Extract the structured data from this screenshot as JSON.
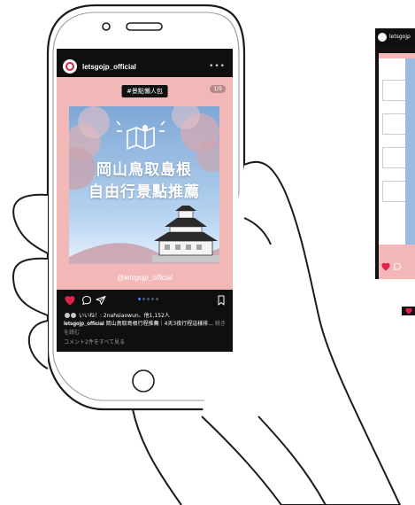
{
  "instagram": {
    "username": "letsgojp_official",
    "tag": "#景點懶人包",
    "counter": "1/9",
    "title_line1": "岡山鳥取島根",
    "title_line2": "自由行景點推薦",
    "watermark": "@letsgojp_official",
    "likes": "いいね！: 2nahsiaowun、他1,152人",
    "caption_user": "letsgojp_official",
    "caption_text": "岡山鳥取島根行程推薦｜4天3夜行程這樣排...",
    "caption_more": "続きを読む",
    "comments": "コメント2件をすべて見る"
  },
  "right_preview": {
    "username_snip": "letsgojp"
  },
  "colors": {
    "post_bg": "#f2b7b7",
    "heart": "#e0224b",
    "phone_screen": "#0f0f0f"
  }
}
